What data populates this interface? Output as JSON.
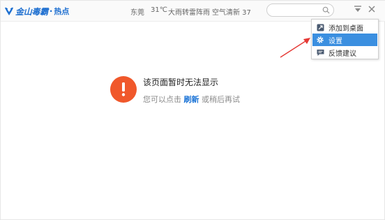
{
  "header": {
    "brand": "金山毒霸",
    "separator": "·",
    "section": "热点"
  },
  "weather": {
    "city": "东莞",
    "temperature": "31℃",
    "description": "大雨转雷阵雨",
    "air_quality": "空气清新 37"
  },
  "search": {
    "value": "",
    "placeholder": ""
  },
  "menu": {
    "items": [
      {
        "label": "添加到桌面",
        "icon": "add-to-desktop-icon"
      },
      {
        "label": "设置",
        "icon": "gear-icon",
        "highlighted": true
      },
      {
        "label": "反馈建议",
        "icon": "feedback-icon"
      }
    ]
  },
  "error": {
    "title": "该页面暂时无法显示",
    "hint_before": "您可以点击",
    "refresh_label": "刷新",
    "hint_after": "或稍后再试"
  },
  "colors": {
    "accent": "#1e6fd0",
    "menu_highlight": "#3b8fe0",
    "error_icon": "#f0582b",
    "annotation_arrow": "#e53935"
  }
}
